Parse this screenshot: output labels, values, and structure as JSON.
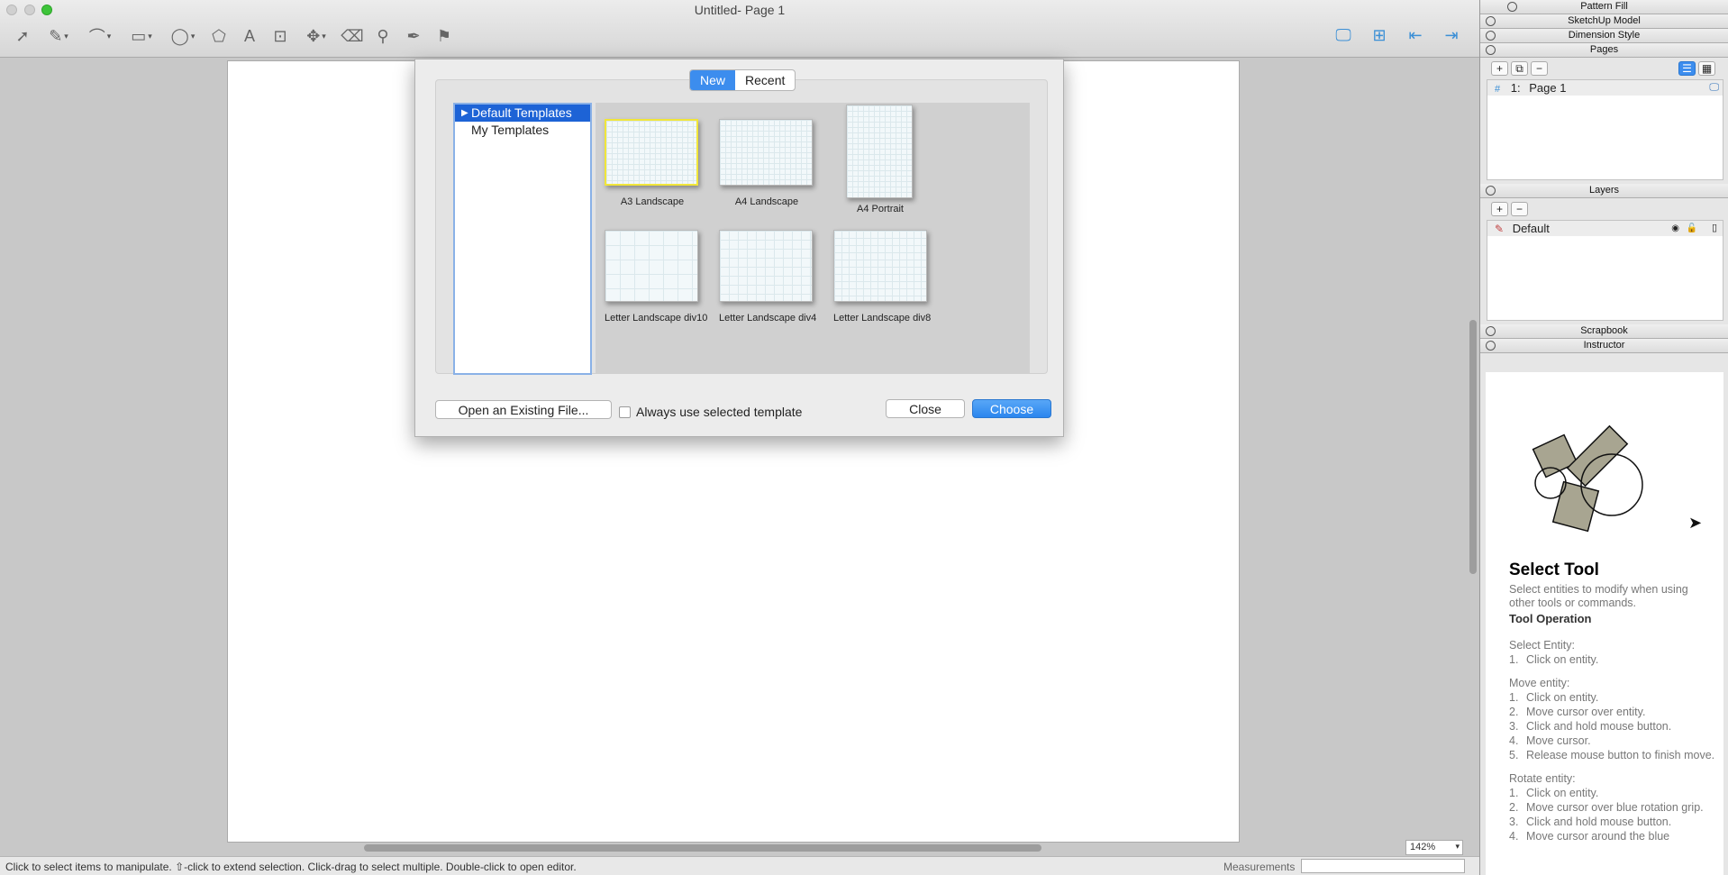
{
  "window": {
    "title": "Untitled- Page 1"
  },
  "toolbar": {
    "tools": [
      {
        "icon": "select-arrow-icon",
        "glyph": "➚"
      },
      {
        "icon": "pencil-icon",
        "glyph": "✎",
        "menu": true
      },
      {
        "icon": "arc-icon",
        "glyph": "⌒",
        "menu": true
      },
      {
        "icon": "rectangle-icon",
        "glyph": "▭",
        "menu": true
      },
      {
        "icon": "circle-icon",
        "glyph": "◯",
        "menu": true
      },
      {
        "icon": "polygon-icon",
        "glyph": "⬠"
      },
      {
        "icon": "text-icon",
        "glyph": "A"
      },
      {
        "icon": "label-icon",
        "glyph": "⊡"
      },
      {
        "icon": "dimension-icon",
        "glyph": "✥",
        "menu": true
      },
      {
        "icon": "eraser-icon",
        "glyph": "⌫"
      },
      {
        "icon": "eyedropper-icon",
        "glyph": "⚲"
      },
      {
        "icon": "split-icon",
        "glyph": "✒"
      },
      {
        "icon": "join-icon",
        "glyph": "⚑"
      }
    ],
    "right_tools": [
      {
        "icon": "display-icon",
        "glyph": "🖵"
      },
      {
        "icon": "add-page-icon",
        "glyph": "⊞"
      },
      {
        "icon": "previous-page-icon",
        "glyph": "⇤"
      },
      {
        "icon": "next-page-icon",
        "glyph": "⇥"
      }
    ]
  },
  "dialog": {
    "tabs": [
      "New",
      "Recent"
    ],
    "active_tab": "New",
    "tree": [
      "Default Templates",
      "My Templates"
    ],
    "templates": [
      {
        "name": "A3 Landscape"
      },
      {
        "name": "A4 Landscape"
      },
      {
        "name": "A4 Portrait"
      },
      {
        "name": "Letter Landscape div10"
      },
      {
        "name": "Letter Landscape div4"
      },
      {
        "name": "Letter Landscape div8"
      }
    ],
    "open_existing": "Open an Existing File...",
    "always_use": "Always use selected template",
    "close": "Close",
    "choose": "Choose"
  },
  "canvas": {
    "zoom": "142%"
  },
  "status": {
    "hint": "Click to select items to manipulate. ⇧-click to extend selection. Click-drag to select multiple. Double-click to open editor.",
    "measurements_label": "Measurements"
  },
  "inspector": {
    "panels": {
      "pattern_fill": "Pattern Fill",
      "sketchup_model": "SketchUp Model",
      "dimension_style": "Dimension Style",
      "pages": "Pages",
      "layers": "Layers",
      "scrapbook": "Scrapbook",
      "instructor": "Instructor"
    },
    "pages": {
      "row_number": "1:",
      "row_name": "Page 1"
    },
    "layers": {
      "row_name": "Default"
    },
    "instructor": {
      "title": "Select Tool",
      "description": "Select entities to modify when using other tools or commands.",
      "heading": "Tool Operation",
      "groups": [
        {
          "title": "Select Entity:",
          "steps": [
            "Click on entity."
          ]
        },
        {
          "title": "Move entity:",
          "steps": [
            "Click on entity.",
            "Move cursor over entity.",
            "Click and hold mouse button.",
            "Move cursor.",
            "Release mouse button to finish move."
          ]
        },
        {
          "title": "Rotate entity:",
          "steps": [
            "Click on entity.",
            "Move cursor over blue rotation grip.",
            "Click and hold mouse button.",
            "Move cursor around the blue"
          ]
        }
      ]
    }
  }
}
